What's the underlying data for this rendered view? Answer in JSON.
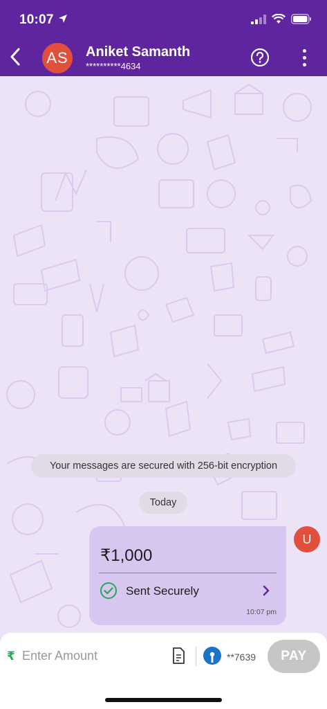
{
  "status_bar": {
    "time": "10:07"
  },
  "header": {
    "avatar_initials": "AS",
    "contact_name": "Aniket Samanth",
    "contact_number": "**********4634"
  },
  "chat": {
    "encryption_notice": "Your messages are secured with 256-bit encryption",
    "date_label": "Today",
    "message": {
      "amount": "₹1,000",
      "status": "Sent Securely",
      "time": "10:07 pm",
      "sender_initial": "U"
    }
  },
  "payment_bar": {
    "currency_symbol": "₹",
    "amount_placeholder": "Enter Amount",
    "bank_account": "**7639",
    "pay_label": "PAY"
  },
  "colors": {
    "brand_purple": "#5f259f",
    "chat_background": "#ece3f6",
    "bubble": "#d7c6f0",
    "avatar_red": "#e0503d",
    "success_green": "#26a65b",
    "pay_disabled": "#c6c6c6"
  },
  "icons": [
    "location-arrow-icon",
    "signal-icon",
    "wifi-icon",
    "battery-icon",
    "back-arrow-icon",
    "help-icon",
    "more-options-icon",
    "check-circle-icon",
    "chevron-right-icon",
    "document-icon",
    "bank-logo-icon"
  ]
}
